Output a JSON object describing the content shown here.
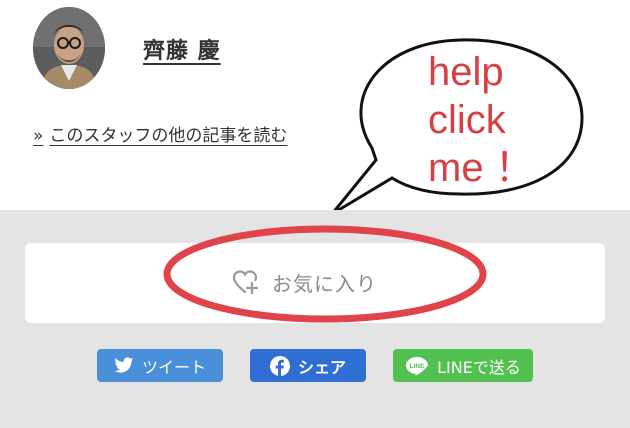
{
  "author": {
    "name": "齊藤 慶",
    "more_link_prefix": "»",
    "more_link_text": "このスタッフの他の記事を読む"
  },
  "callout": {
    "lines": [
      "help",
      "click",
      "me ！"
    ],
    "text_color": "#d64045",
    "outline_color": "#111111"
  },
  "favorite": {
    "label": "お気に入り",
    "icon": "heart-plus-icon",
    "highlight_color": "#e0434a"
  },
  "share": {
    "twitter_label": "ツイート",
    "twitter_icon": "twitter-bird-icon",
    "twitter_color": "#4a90d9",
    "facebook_label": "シェア",
    "facebook_icon": "facebook-icon",
    "facebook_color": "#2f6fd3",
    "line_label": "LINEで送る",
    "line_icon": "line-icon",
    "line_icon_text": "LINE",
    "line_color": "#53c150"
  }
}
